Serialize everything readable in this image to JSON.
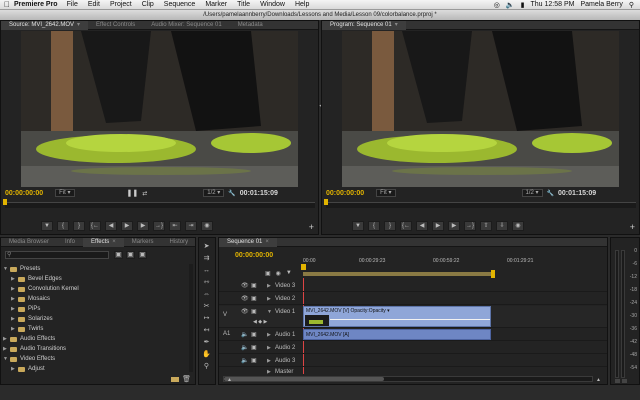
{
  "menubar": {
    "app": "Premiere Pro",
    "items": [
      "File",
      "Edit",
      "Project",
      "Clip",
      "Sequence",
      "Marker",
      "Title",
      "Window",
      "Help"
    ],
    "clock": "Thu 12:58 PM",
    "user": "Pamela Berry"
  },
  "window": {
    "title": "/Users/pamelaannberry/Downloads/Lessons and Media/Lesson 09/colorbalance.prproj *"
  },
  "source": {
    "tabs": [
      "Source: MVI_2642.MOV",
      "Effect Controls",
      "Audio Mixer: Sequence 01",
      "Metadata"
    ],
    "timecode_in": "00:00:00:00",
    "fit": "Fit",
    "resolution": "1/2",
    "duration": "00:01:15:09"
  },
  "program": {
    "tabs": [
      "Program: Sequence 01"
    ],
    "timecode_in": "00:00:00:00",
    "fit": "Fit",
    "resolution": "1/2",
    "duration": "00:01:15:09"
  },
  "project": {
    "tabs": [
      "Media Browser",
      "Info",
      "Effects",
      "Markers",
      "History"
    ],
    "tree": [
      {
        "label": "Presets",
        "level": 0,
        "open": true
      },
      {
        "label": "Bevel Edges",
        "level": 1
      },
      {
        "label": "Convolution Kernel",
        "level": 1
      },
      {
        "label": "Mosaics",
        "level": 1
      },
      {
        "label": "PiPs",
        "level": 1
      },
      {
        "label": "Solarizes",
        "level": 1
      },
      {
        "label": "Twirls",
        "level": 1
      },
      {
        "label": "Audio Effects",
        "level": 0
      },
      {
        "label": "Audio Transitions",
        "level": 0
      },
      {
        "label": "Video Effects",
        "level": 0,
        "open": true
      },
      {
        "label": "Adjust",
        "level": 1
      }
    ]
  },
  "timeline": {
    "tab": "Sequence 01",
    "timecode": "00:00:00:00",
    "ruler": [
      "00:00",
      "00:00:29:23",
      "00:00:59:22",
      "00:01:29:21"
    ],
    "video_tracks": [
      "Video 3",
      "Video 2",
      "Video 1"
    ],
    "audio_tracks": [
      "Audio 1",
      "Audio 2",
      "Audio 3"
    ],
    "master": "Master",
    "video_clip": "MVI_2642.MOV [V]  Opacity:Opacity ▾",
    "audio_clip": "MVI_2642.MOV [A]",
    "track_tag_v": "V",
    "track_tag_a": "A1"
  },
  "meters": {
    "scale": [
      "0",
      "-6",
      "-12",
      "-18",
      "-24",
      "-30",
      "-36",
      "-42",
      "-48",
      "-54"
    ]
  },
  "colors": {
    "timecode": "#e2b400",
    "accent": "#4f6fb6",
    "clip_video": "#8fa6d8",
    "clip_audio": "#6e86c4"
  }
}
